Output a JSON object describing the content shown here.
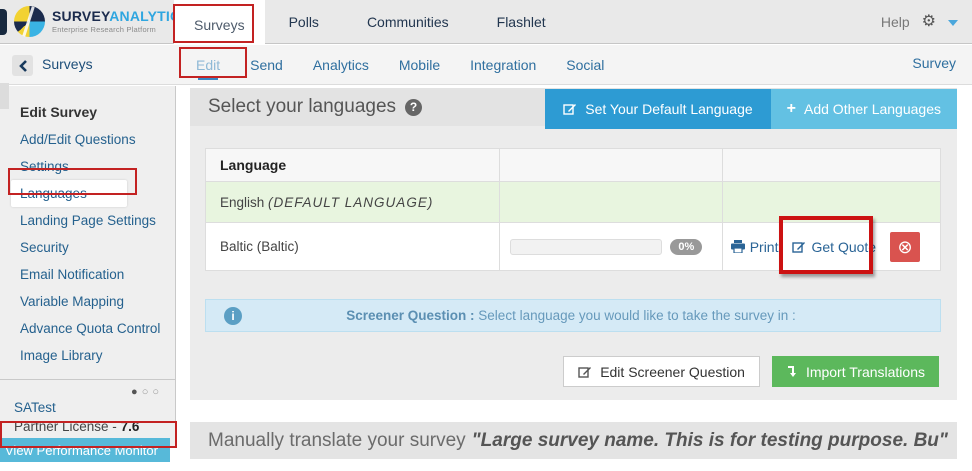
{
  "header": {
    "logo": {
      "title_primary": "SURVEY",
      "title_secondary": "ANALYTICS",
      "subtitle": "Enterprise Research Platform"
    },
    "nav": [
      {
        "label": "Surveys",
        "active": true
      },
      {
        "label": "Polls",
        "active": false
      },
      {
        "label": "Communities",
        "active": false
      },
      {
        "label": "Flashlet",
        "active": false
      }
    ],
    "help_label": "Help",
    "gear_glyph": "⚙"
  },
  "subnav": {
    "back_label": "Surveys",
    "tabs": [
      {
        "label": "Edit",
        "active": true
      },
      {
        "label": "Send",
        "active": false
      },
      {
        "label": "Analytics",
        "active": false
      },
      {
        "label": "Mobile",
        "active": false
      },
      {
        "label": "Integration",
        "active": false
      },
      {
        "label": "Social",
        "active": false
      }
    ],
    "right_label": "Survey"
  },
  "sidebar": {
    "heading": "Edit Survey",
    "items": [
      "Add/Edit Questions",
      "Settings",
      "Languages",
      "Landing Page Settings",
      "Security",
      "Email Notification",
      "Variable Mapping",
      "Advance Quota Control",
      "Image Library"
    ],
    "active_item": "Languages",
    "dots": {
      "filled": "●",
      "empty": "○"
    },
    "account": {
      "name": "SATest",
      "license_label": "Partner License -",
      "license_value": "7.6",
      "monitor_button": "View Performance Monitor"
    }
  },
  "main": {
    "title": "Select your languages",
    "help_glyph": "?",
    "buttons": {
      "default_language": "Set Your Default Language",
      "add_languages": "Add Other Languages",
      "plus_glyph": "+"
    },
    "table": {
      "header": "Language",
      "rows": [
        {
          "language": "English",
          "note": "(DEFAULT LANGUAGE)"
        },
        {
          "language": "Baltic (Baltic)",
          "progress": "0%",
          "print_label": "Print",
          "quote_label": "Get Quote",
          "delete_glyph": "⊗"
        }
      ]
    },
    "banner": {
      "info_glyph": "i",
      "bold": "Screener Question :",
      "text": "Select language you would like to take the survey in :"
    },
    "actions": {
      "edit_screener": "Edit Screener Question",
      "import": "Import Translations"
    },
    "footer": {
      "prefix": "Manually translate your survey",
      "survey_name": "\"Large survey name. This is for testing purpose. Bu\""
    }
  },
  "colors": {
    "brand_navy": "#1b2b4d",
    "brand_cyan": "#2fa6e0",
    "primary_button": "#2d9bd3",
    "secondary_button": "#63c1e3",
    "success_button": "#5cb85c",
    "danger_button": "#d9534f",
    "monitor_button": "#57b9d9",
    "default_row_green": "#e8f5df",
    "banner_blue": "#d5eaf6",
    "annotation_red": "#c32222"
  }
}
